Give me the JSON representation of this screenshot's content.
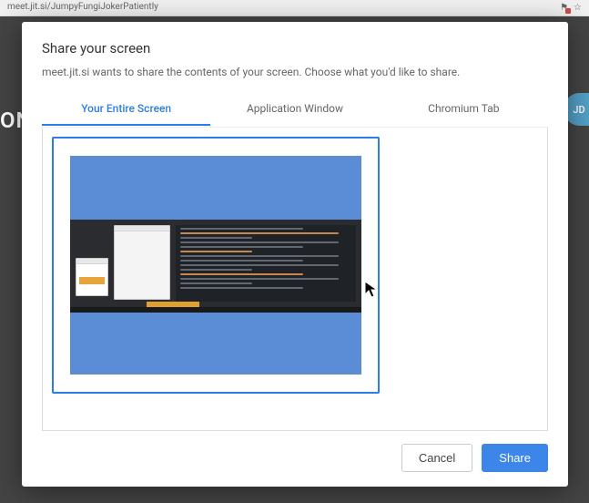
{
  "browser": {
    "url_fragment": "meet.jit.si/JumpyFungiJokerPatiently",
    "star": "☆",
    "flag": "⚑"
  },
  "background": {
    "left_text": "ON",
    "avatar_initials": "JD"
  },
  "dialog": {
    "title": "Share your screen",
    "subtitle": "meet.jit.si wants to share the contents of your screen. Choose what you'd like to share.",
    "tabs": [
      {
        "label": "Your Entire Screen",
        "active": true
      },
      {
        "label": "Application Window",
        "active": false
      },
      {
        "label": "Chromium Tab",
        "active": false
      }
    ],
    "preview": {
      "selected": true
    },
    "buttons": {
      "cancel": "Cancel",
      "share": "Share"
    }
  }
}
